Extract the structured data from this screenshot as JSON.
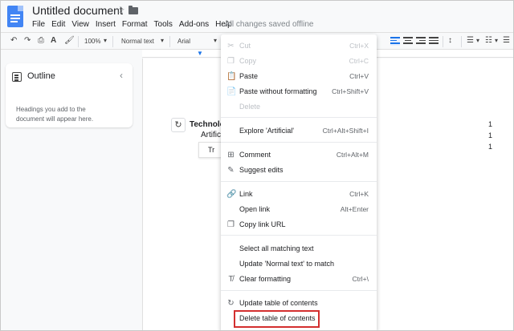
{
  "header": {
    "title": "Untitled document",
    "menu": [
      "File",
      "Edit",
      "View",
      "Insert",
      "Format",
      "Tools",
      "Add-ons",
      "Help"
    ],
    "saved_status": "All changes saved offline"
  },
  "toolbar": {
    "zoom": "100%",
    "style": "Normal text",
    "font": "Arial"
  },
  "outline": {
    "title": "Outline",
    "hint": "Headings you add to the document will appear here."
  },
  "document": {
    "toc_heading": "Technolo",
    "toc_sub1": "Artifici",
    "toc_sub2": "Tr",
    "page_numbers": [
      "1",
      "1",
      "1"
    ]
  },
  "context_menu": {
    "cut": {
      "label": "Cut",
      "shortcut": "Ctrl+X"
    },
    "copy": {
      "label": "Copy",
      "shortcut": "Ctrl+C"
    },
    "paste": {
      "label": "Paste",
      "shortcut": "Ctrl+V"
    },
    "paste_plain": {
      "label": "Paste without formatting",
      "shortcut": "Ctrl+Shift+V"
    },
    "delete": {
      "label": "Delete"
    },
    "explore": {
      "label": "Explore 'Artificial'",
      "shortcut": "Ctrl+Alt+Shift+I"
    },
    "comment": {
      "label": "Comment",
      "shortcut": "Ctrl+Alt+M"
    },
    "suggest": {
      "label": "Suggest edits"
    },
    "link": {
      "label": "Link",
      "shortcut": "Ctrl+K"
    },
    "open_link": {
      "label": "Open link",
      "shortcut": "Alt+Enter"
    },
    "copy_link": {
      "label": "Copy link URL"
    },
    "select_all": {
      "label": "Select all matching text"
    },
    "update_normal": {
      "label": "Update 'Normal text' to match"
    },
    "clear_fmt": {
      "label": "Clear formatting",
      "shortcut": "Ctrl+\\"
    },
    "update_toc": {
      "label": "Update table of contents"
    },
    "delete_toc": {
      "label": "Delete table of contents"
    }
  },
  "colors": {
    "accent": "#1a73e8",
    "highlight_box": "#d32f2f",
    "doc_icon": "#4285f4"
  }
}
